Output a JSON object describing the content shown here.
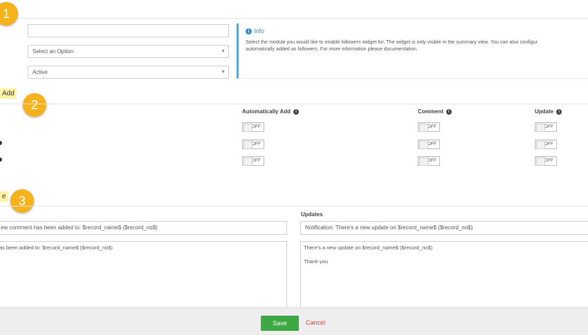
{
  "badges": {
    "b1": "1",
    "b2": "2",
    "b3": "3"
  },
  "highlights": {
    "auto_add": "Add",
    "template": "e"
  },
  "form": {
    "name_value": "",
    "module_select": "Select an Option",
    "status_select": "Active"
  },
  "info": {
    "title": "Info",
    "line1": "Select the module you would like to enable followers widget for. The widget is only visible in the summary view. You can also configur",
    "line2": "automatically added as followers. For more information please documentation."
  },
  "columns": {
    "auto_add": "Automatically Add",
    "comment": "Comment",
    "update": "Update"
  },
  "toggle_label": "OFF",
  "templates": {
    "updates_label": "Updates",
    "comment_subject": "ew comment has been added to: $record_name$ ($record_no$)",
    "comment_body": "as been added to: $record_name$ ($record_no$)",
    "update_subject": "Notification: There's a new update on $record_name$ ($record_no$)",
    "update_body": "There's a new update on $record_name$ ($record_no$)\n\nThank you"
  },
  "footer": {
    "save": "Save",
    "cancel": "Cancel"
  },
  "colors": {
    "accent_green": "#3da844",
    "badge_orange": "#f5b21b",
    "info_blue": "#3a8cc4",
    "cancel_red": "#d9433a"
  }
}
